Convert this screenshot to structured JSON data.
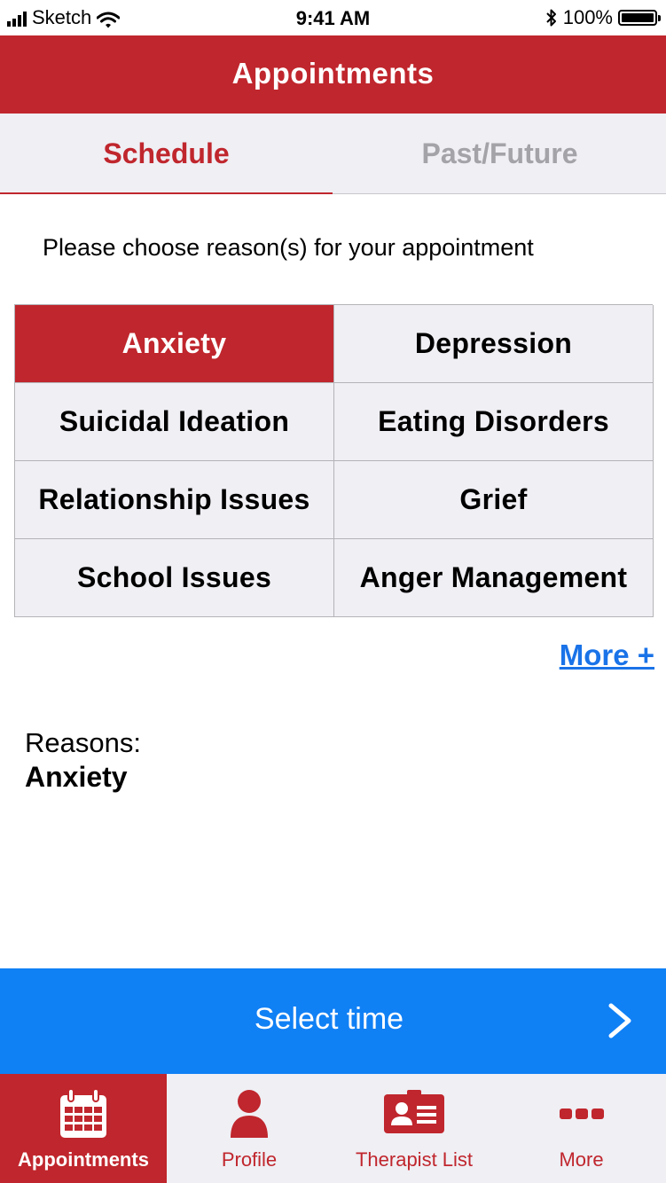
{
  "status_bar": {
    "carrier": "Sketch",
    "time": "9:41 AM",
    "battery": "100%"
  },
  "header": {
    "title": "Appointments"
  },
  "tabs": [
    {
      "label": "Schedule",
      "active": true
    },
    {
      "label": "Past/Future",
      "active": false
    }
  ],
  "instruction": "Please choose reason(s) for your appointment",
  "reasons_grid": [
    {
      "label": "Anxiety",
      "selected": true
    },
    {
      "label": "Depression",
      "selected": false
    },
    {
      "label": "Suicidal Ideation",
      "selected": false
    },
    {
      "label": "Eating Disorders",
      "selected": false
    },
    {
      "label": "Relationship Issues",
      "selected": false
    },
    {
      "label": "Grief",
      "selected": false
    },
    {
      "label": "School Issues",
      "selected": false
    },
    {
      "label": "Anger Management",
      "selected": false
    }
  ],
  "more_link": "More +",
  "summary": {
    "label": "Reasons:",
    "value": "Anxiety"
  },
  "cta": {
    "label": "Select time",
    "icon": "chevron-right-icon"
  },
  "tab_bar": [
    {
      "label": "Appointments",
      "icon": "calendar-icon",
      "active": true
    },
    {
      "label": "Profile",
      "icon": "person-icon",
      "active": false
    },
    {
      "label": "Therapist List",
      "icon": "id-card-icon",
      "active": false
    },
    {
      "label": "More",
      "icon": "ellipsis-icon",
      "active": false
    }
  ],
  "colors": {
    "brand_red": "#c0262d",
    "action_blue": "#1080f5",
    "link_blue": "#1a73e8",
    "tab_gray": "#efeff4"
  }
}
